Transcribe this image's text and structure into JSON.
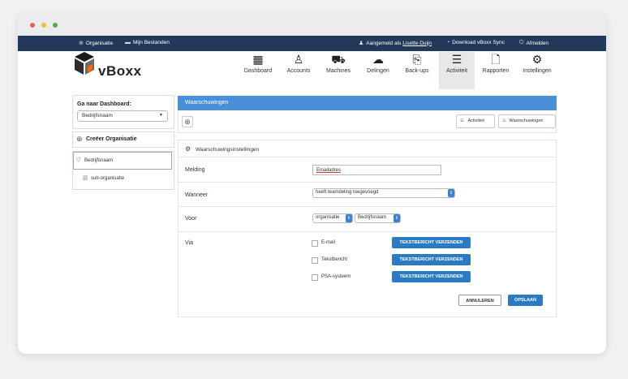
{
  "topbar": {
    "organisatie": "Organisatie",
    "bestanden": "Mijn Bestanden",
    "aangemeld_prefix": "Aangemeld als",
    "user": "Lisette Duijn",
    "download": "Download vBoxx Sync",
    "afmelden": "Afmelden"
  },
  "brand": "vBoxx",
  "nav": [
    {
      "label": "Dashboard",
      "icon": "dashboard-icon"
    },
    {
      "label": "Accounts",
      "icon": "user-icon"
    },
    {
      "label": "Machines",
      "icon": "machine-icon"
    },
    {
      "label": "Delingen",
      "icon": "cloud-share-icon"
    },
    {
      "label": "Back-ups",
      "icon": "backup-icon"
    },
    {
      "label": "Activiteit",
      "icon": "list-icon"
    },
    {
      "label": "Rapporten",
      "icon": "report-icon"
    },
    {
      "label": "Instellingen",
      "icon": "gear-icon"
    }
  ],
  "sidebar": {
    "goto_label": "Ga naar Dashboard:",
    "goto_value": "Bedrijfsnaam",
    "create_org": "Creëer Organisatie",
    "tree_root": "Bedrijfsnaam",
    "tree_child": "sub-organisatie"
  },
  "main": {
    "header": "Waarschuwingen",
    "activiteit_btn": "Activiteit",
    "waarschuwingen_btn": "Waarschuwingen",
    "section_title": "Waarschuwingsinstellingen",
    "melding_label": "Melding",
    "melding_value": "Emailadres",
    "wanneer_label": "Wanneer",
    "wanneer_value": "heeft teamdeling toegevoegd",
    "voor_label": "Voor",
    "voor_value1": "organisatie",
    "voor_value2": "Bedrijfsnaam",
    "via_label": "Via",
    "via_options": [
      "E-mail",
      "Tekstbericht",
      "PSA-systeem"
    ],
    "send_btn": "TEKSTBERICHT VERZENDEN",
    "annuleren": "ANNULEREN",
    "opslaan": "OPSLAAN"
  },
  "colors": {
    "topbar": "#22395a",
    "accent": "#4a90d9",
    "button": "#2b7bc4"
  }
}
